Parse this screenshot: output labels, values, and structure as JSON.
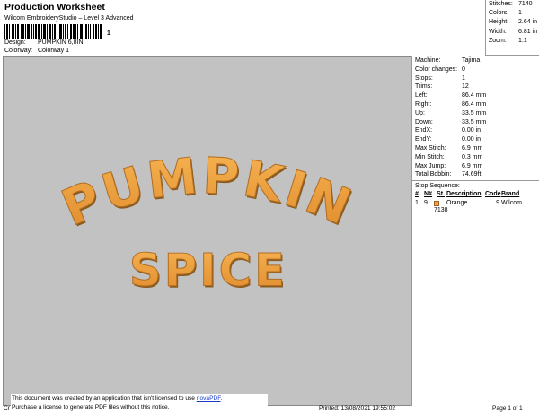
{
  "header": {
    "title": "Production Worksheet",
    "subtitle": "Wilcom EmbroideryStudio – Level 3 Advanced",
    "barcode_mark": "1",
    "design_label": "Design:",
    "design_value": "PUMPKIN 6,8IN",
    "colorway_label": "Colorway:",
    "colorway_value": "Colorway 1"
  },
  "stats": [
    {
      "label": "Stitches:",
      "value": "7140"
    },
    {
      "label": "Colors:",
      "value": "1"
    },
    {
      "label": "Height:",
      "value": "2.64 in"
    },
    {
      "label": "Width:",
      "value": "6.81 in"
    },
    {
      "label": "Zoom:",
      "value": "1:1"
    }
  ],
  "design": {
    "line1": "PUMPKIN",
    "line2": "SPICE",
    "thread_color": "#f0a040",
    "canvas_color": "#c2c2c2"
  },
  "properties": [
    {
      "label": "Machine:",
      "value": "Tajima"
    },
    {
      "label": "Color changes:",
      "value": "0"
    },
    {
      "label": "Stops:",
      "value": "1"
    },
    {
      "label": "Trims:",
      "value": "12"
    },
    {
      "label": "Left:",
      "value": "86.4 mm"
    },
    {
      "label": "Right:",
      "value": "86.4 mm"
    },
    {
      "label": "Up:",
      "value": "33.5 mm"
    },
    {
      "label": "Down:",
      "value": "33.5 mm"
    },
    {
      "label": "EndX:",
      "value": "0.00 in"
    },
    {
      "label": "EndY:",
      "value": "0.00 in"
    },
    {
      "label": "Max Stitch:",
      "value": "6.9 mm"
    },
    {
      "label": "Min Stitch:",
      "value": "0.3 mm"
    },
    {
      "label": "Max Jump:",
      "value": "6.9 mm"
    },
    {
      "label": "Total Bobbin:",
      "value": "74.69ft"
    }
  ],
  "stop_sequence": {
    "title": "Stop Sequence:",
    "headers": [
      "#",
      "N#",
      "St.",
      "Description",
      "Code",
      "Brand"
    ],
    "rows": [
      {
        "num": "1.",
        "n": "9",
        "st": "7138",
        "desc": "Orange",
        "code": "9",
        "brand": "Wilcom"
      }
    ]
  },
  "footer": {
    "notice_line1": "This document was created by an application that isn't licensed to use ",
    "notice_link": "novaPDF",
    "notice_end": ".",
    "notice_line2": "Purchase a license to generate PDF files without this notice.",
    "cr": "Cr",
    "printed": "Printed:  13/08/2021 19:55:02",
    "page": "Page 1 of 1"
  }
}
